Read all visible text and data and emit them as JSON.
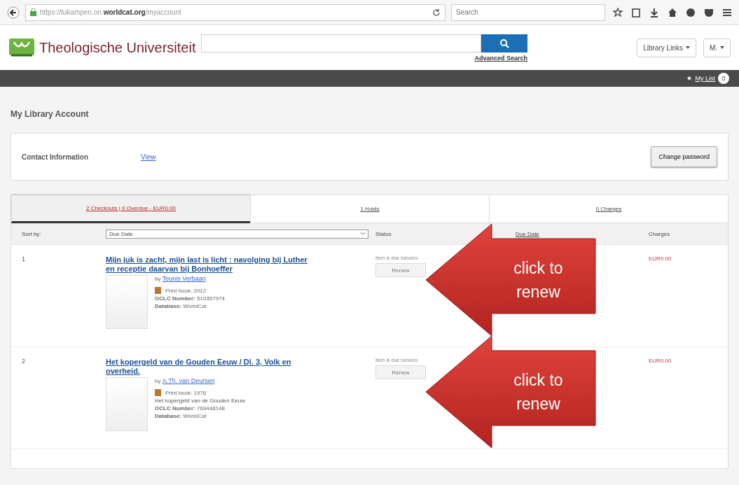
{
  "browser": {
    "url_prefix": "https://tukampen.on.",
    "url_domain": "worldcat.org",
    "url_path": "/myaccount",
    "search_placeholder": "Search"
  },
  "header": {
    "logo_text": "Theologische Universiteit",
    "advanced_search": "Advanced Search",
    "library_links": "Library Links",
    "user_menu": "M."
  },
  "nav": {
    "my_list": "My List",
    "count": "0"
  },
  "account": {
    "title": "My Library Account",
    "contact_label": "Contact Information",
    "view_link": "View",
    "change_password": "Change password"
  },
  "tabs": [
    {
      "label": "2 Checkouts | 0 Overdue - EUR0.00",
      "selected": true
    },
    {
      "label": "1 Holds",
      "selected": false
    },
    {
      "label": "0 Charges",
      "selected": false
    }
  ],
  "table": {
    "sort_label": "Sort by:",
    "sort_value": "Due Date",
    "columns": [
      "Status",
      "Due Date",
      "Charges"
    ],
    "rows": [
      {
        "number": "1",
        "title": "Mijn juk is zacht, mijn last is licht : navolging bij Luther en receptie daarvan bij Bonhoeffer",
        "by": "by",
        "author": "Teunis Verbaan",
        "format": "Print book: 2012",
        "series": null,
        "oclc_label": "OCLC Number:",
        "oclc": "510357974",
        "database_label": "Database:",
        "database": "WorldCat",
        "status": "Item is due tomorro",
        "renew": "Renew",
        "charge": "EUR0.00"
      },
      {
        "number": "2",
        "title": "Het kopergeld van de Gouden Eeuw / Dl. 3, Volk en overheid.",
        "by": "by",
        "author": "A.Th. van Deursen",
        "format": "Print book: 1978",
        "series": "Het kopergeld van de Gouden Eeuw",
        "oclc_label": "OCLC Number:",
        "oclc": "769448148",
        "database_label": "Database:",
        "database": "WorldCat",
        "status": "Item is due tomorro",
        "renew": "Renew",
        "charge": "EUR0.00"
      }
    ]
  },
  "callouts": [
    {
      "text": "click to renew"
    },
    {
      "text": "click to renew"
    }
  ]
}
